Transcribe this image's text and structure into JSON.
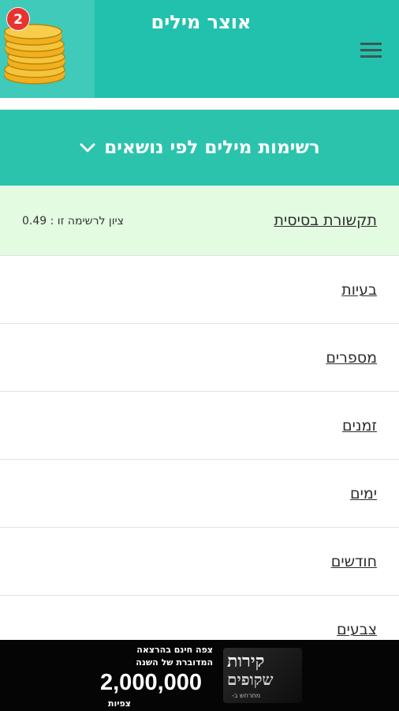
{
  "header": {
    "title": "אוצר מילים",
    "coin_count": "2",
    "colors": {
      "header_bg": "#22c1ad",
      "badge": "#e8332f"
    }
  },
  "section": {
    "title": "רשימות מילים לפי נושאים",
    "expand_icon": "chevron-down-icon"
  },
  "lists": [
    {
      "label": "תקשורת בסיסית",
      "score": "ציון לרשימה זו : 0.49",
      "selected": true
    },
    {
      "label": "בעיות"
    },
    {
      "label": "מספרים"
    },
    {
      "label": "זמנים"
    },
    {
      "label": "ימים"
    },
    {
      "label": "חודשים"
    },
    {
      "label": "צבעים"
    }
  ],
  "ad": {
    "brand_line1": "קירות",
    "brand_line2": "שקופים",
    "brand_line3": "מתרחש ב-",
    "line1": "צפה חינם בהרצאה",
    "line2": "המדוברת של השנה",
    "number": "2,000,000",
    "views": "צפיות"
  }
}
